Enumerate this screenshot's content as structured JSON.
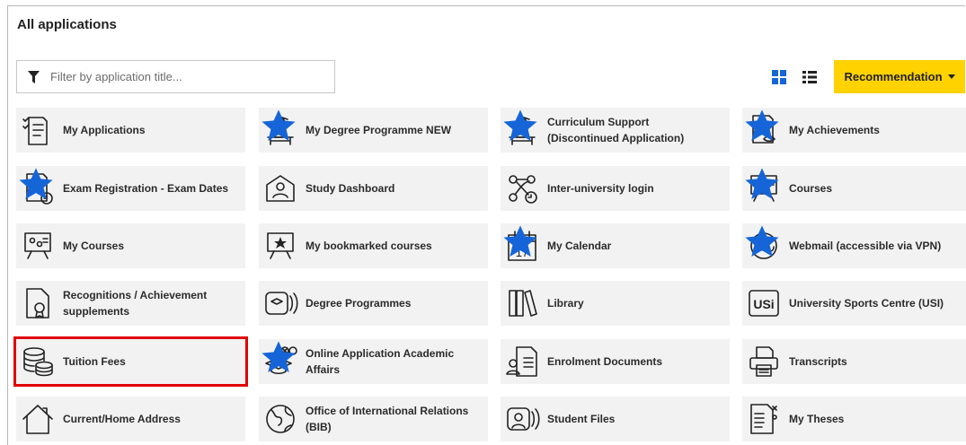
{
  "header": {
    "title": "All applications"
  },
  "filter": {
    "placeholder": "Filter by application title..."
  },
  "toolbar": {
    "recommendation_label": "Recommendation"
  },
  "colors": {
    "star": "#1565d8",
    "grid_active": "#1565d8",
    "recommendation_bg": "#ffd200",
    "selection_outline": "#e00000",
    "tile_bg": "#f2f2f2"
  },
  "tiles": [
    {
      "label": "My Applications",
      "icon": "checklist-icon",
      "starred": false
    },
    {
      "label": "My Degree Programme NEW",
      "icon": "desk-lamp-icon",
      "starred": true
    },
    {
      "label": "Curriculum Support (Discontinued Application)",
      "icon": "desk-lamp-icon",
      "starred": true
    },
    {
      "label": "My Achievements",
      "icon": "grade-sheet-icon",
      "starred": true
    },
    {
      "label": "Exam Registration - Exam Dates",
      "icon": "exam-sheet-icon",
      "starred": true
    },
    {
      "label": "Study Dashboard",
      "icon": "study-dashboard-icon",
      "starred": false
    },
    {
      "label": "Inter-university login",
      "icon": "network-login-icon",
      "starred": false
    },
    {
      "label": "Courses",
      "icon": "chalkboard-icon",
      "starred": true
    },
    {
      "label": "My Courses",
      "icon": "chalkboard-icon",
      "starred": false
    },
    {
      "label": "My bookmarked courses",
      "icon": "bookmarked-board-icon",
      "starred": false
    },
    {
      "label": "My Calendar",
      "icon": "calendar-icon",
      "starred": true,
      "badge": "17"
    },
    {
      "label": "Webmail (accessible via VPN)",
      "icon": "at-sign-icon",
      "starred": true
    },
    {
      "label": "Recognitions / Achievement supplements",
      "icon": "certificate-icon",
      "starred": false
    },
    {
      "label": "Degree Programmes",
      "icon": "degree-programmes-icon",
      "starred": false
    },
    {
      "label": "Library",
      "icon": "books-icon",
      "starred": false
    },
    {
      "label": "University Sports Centre (USI)",
      "icon": "usi-logo-icon",
      "starred": false,
      "badge": "USi"
    },
    {
      "label": "Tuition Fees",
      "icon": "coin-stack-icon",
      "starred": false,
      "selected": true
    },
    {
      "label": "Online Application Academic Affairs",
      "icon": "graduation-cap-icon",
      "starred": true
    },
    {
      "label": "Enrolment Documents",
      "icon": "id-document-icon",
      "starred": false
    },
    {
      "label": "Transcripts",
      "icon": "printer-icon",
      "starred": false
    },
    {
      "label": "Current/Home Address",
      "icon": "house-icon",
      "starred": false
    },
    {
      "label": "Office of International Relations (BIB)",
      "icon": "globe-icon",
      "starred": false
    },
    {
      "label": "Student Files",
      "icon": "student-files-icon",
      "starred": false
    },
    {
      "label": "My Theses",
      "icon": "thesis-document-icon",
      "starred": false
    }
  ]
}
